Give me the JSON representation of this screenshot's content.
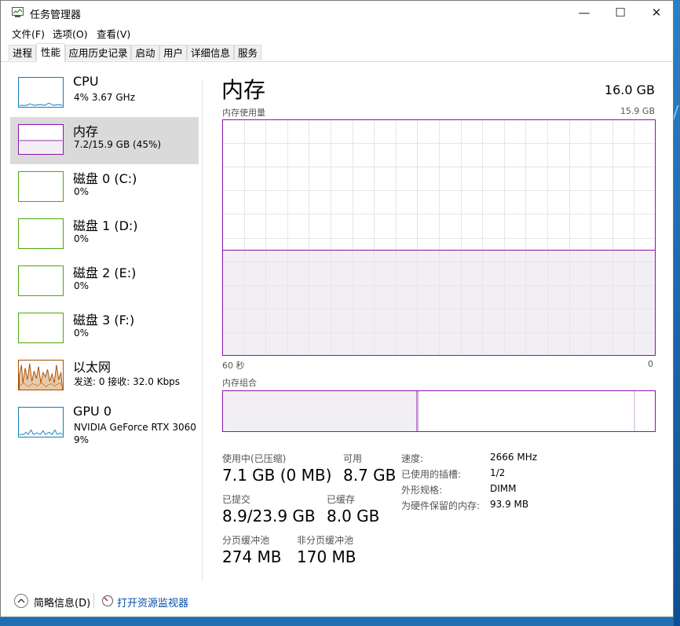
{
  "window": {
    "title": "任务管理器"
  },
  "menu": [
    "文件(F)",
    "选项(O)",
    "查看(V)"
  ],
  "tabs": [
    "进程",
    "性能",
    "应用历史记录",
    "启动",
    "用户",
    "详细信息",
    "服务"
  ],
  "active_tab": "性能",
  "sidebar": [
    {
      "name": "CPU",
      "sub": "4%  3.67 GHz",
      "color": "#117dbb"
    },
    {
      "name": "内存",
      "sub": "7.2/15.9 GB (45%)",
      "color": "#8b12ae"
    },
    {
      "name": "磁盘 0 (C:)",
      "sub": "0%",
      "color": "#4da60c"
    },
    {
      "name": "磁盘 1 (D:)",
      "sub": "0%",
      "color": "#4da60c"
    },
    {
      "name": "磁盘 2 (E:)",
      "sub": "0%",
      "color": "#4da60c"
    },
    {
      "name": "磁盘 3 (F:)",
      "sub": "0%",
      "color": "#4da60c"
    },
    {
      "name": "以太网",
      "sub": "发送: 0  接收: 32.0 Kbps",
      "color": "#a74f01"
    },
    {
      "name": "GPU 0",
      "sub": "NVIDIA GeForce RTX 3060",
      "sub2": "9%",
      "color": "#117dbb"
    }
  ],
  "main": {
    "title": "内存",
    "total": "16.0 GB",
    "usage_label": "内存使用量",
    "usage_max": "15.9 GB",
    "time_left": "60 秒",
    "time_right": "0",
    "usage_fraction": 0.45,
    "composition_label": "内存组合",
    "stats": {
      "in_use_label": "使用中(已压缩)",
      "in_use": "7.1 GB (0 MB)",
      "available_label": "可用",
      "available": "8.7 GB",
      "committed_label": "已提交",
      "committed": "8.9/23.9 GB",
      "cached_label": "已缓存",
      "cached": "8.0 GB",
      "paged_label": "分页缓冲池",
      "paged": "274 MB",
      "nonpaged_label": "非分页缓冲池",
      "nonpaged": "170 MB"
    },
    "props": [
      {
        "label": "速度:",
        "value": "2666 MHz"
      },
      {
        "label": "已使用的插槽:",
        "value": "1/2"
      },
      {
        "label": "外形规格:",
        "value": "DIMM"
      },
      {
        "label": "为硬件保留的内存:",
        "value": "93.9 MB"
      }
    ]
  },
  "footer": {
    "summary": "简略信息(D)",
    "monitor": "打开资源监视器"
  }
}
